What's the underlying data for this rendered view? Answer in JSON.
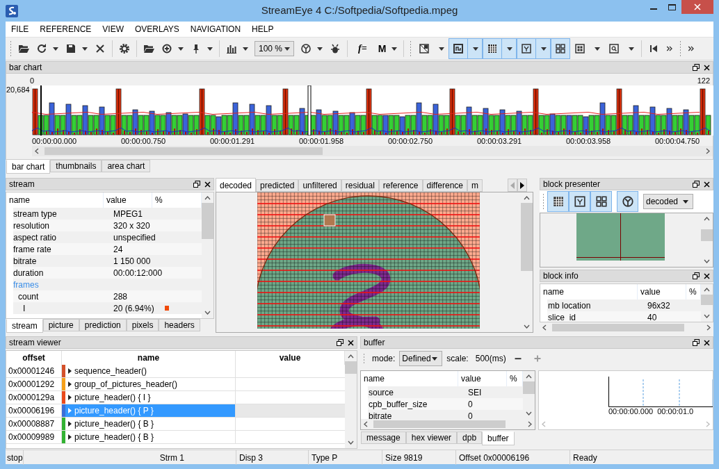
{
  "window": {
    "title": "StreamEye 4 C:/Softpedia/Softpedia.mpeg"
  },
  "menu": [
    "FILE",
    "REFERENCE",
    "VIEW",
    "OVERLAYS",
    "NAVIGATION",
    "HELP"
  ],
  "toolbar": {
    "zoom": "100 %",
    "formula": "f=",
    "macro": "M",
    "view_modes": [
      {
        "selected": false
      },
      {
        "selected": true
      },
      {
        "selected": true
      },
      {
        "selected": true
      },
      {
        "selected": true
      },
      {
        "selected": false
      },
      {
        "selected": false
      }
    ]
  },
  "bar_chart": {
    "title": "bar chart",
    "first_frame": "0",
    "last_frame": "122",
    "max_size": "20,684",
    "times": [
      "00:00:00.000",
      "00:00:00.750",
      "00:00:01.291",
      "00:00:01.958",
      "00:00:02.750",
      "00:00:03.291",
      "00:00:03.958",
      "00:00:04.750"
    ],
    "tabs": [
      {
        "label": "bar chart",
        "selected": true
      },
      {
        "label": "thumbnails",
        "selected": false
      },
      {
        "label": "area chart",
        "selected": false
      }
    ]
  },
  "stream": {
    "title": "stream",
    "columns": [
      "name",
      "value",
      "%"
    ],
    "rows": [
      {
        "kind": "property",
        "name": "stream type",
        "value": "MPEG1"
      },
      {
        "kind": "property",
        "name": "resolution",
        "value": "320 x 320"
      },
      {
        "kind": "property",
        "name": "aspect ratio",
        "value": "unspecified"
      },
      {
        "kind": "property",
        "name": "frame rate",
        "value": "24"
      },
      {
        "kind": "property",
        "name": "bitrate",
        "value": "1 150 000"
      },
      {
        "kind": "property",
        "name": "duration",
        "value": "00:00:12:000"
      },
      {
        "kind": "section",
        "name": "frames",
        "children": [
          {
            "kind": "property",
            "name": "count",
            "value": "288",
            "children": [
              {
                "kind": "property",
                "name": "I",
                "value": "20 (6.94%)",
                "color": "#f04a0a"
              }
            ]
          }
        ]
      }
    ],
    "tabs": [
      {
        "label": "stream",
        "selected": true
      },
      {
        "label": "picture",
        "selected": false
      },
      {
        "label": "prediction",
        "selected": false
      },
      {
        "label": "pixels",
        "selected": false
      },
      {
        "label": "headers",
        "selected": false
      }
    ]
  },
  "picture_tabs": [
    {
      "label": "decoded",
      "selected": true
    },
    {
      "label": "predicted",
      "selected": false
    },
    {
      "label": "unfiltered",
      "selected": false
    },
    {
      "label": "residual",
      "selected": false
    },
    {
      "label": "reference",
      "selected": false
    },
    {
      "label": "difference",
      "selected": false
    },
    {
      "label": "m",
      "selected": false
    }
  ],
  "block_presenter": {
    "title": "block presenter",
    "view": "decoded",
    "modes": [
      {
        "selected": true
      },
      {
        "selected": true
      },
      {
        "selected": true
      },
      {
        "selected": true
      }
    ]
  },
  "block_info": {
    "title": "block info",
    "columns": [
      "name",
      "value",
      "%"
    ],
    "rows": [
      {
        "name": "mb location",
        "value": "96x32"
      },
      {
        "name": "slice_id",
        "value": "40"
      }
    ]
  },
  "stream_viewer": {
    "title": "stream viewer",
    "columns": [
      "offset",
      "name",
      "value"
    ],
    "rows": [
      {
        "offset": "0x00001246",
        "name": "sequence_header()",
        "color": "#d4502a",
        "selected": false
      },
      {
        "offset": "0x00001292",
        "name": "group_of_pictures_header()",
        "color": "#f5a01a",
        "selected": false
      },
      {
        "offset": "0x0000129a",
        "name": "picture_header() { I }",
        "color": "#ea4a1c",
        "selected": false
      },
      {
        "offset": "0x00006196",
        "name": "picture_header() { P }",
        "color": "#3b6fd6",
        "selected": true
      },
      {
        "offset": "0x00008887",
        "name": "picture_header() { B }",
        "color": "#33b233",
        "selected": false
      },
      {
        "offset": "0x00009989",
        "name": "picture_header() { B }",
        "color": "#33b233",
        "selected": false
      }
    ]
  },
  "buffer": {
    "title": "buffer",
    "mode_label": "mode:",
    "mode": "Defined",
    "scale_label": "scale:",
    "scale": "500(ms)",
    "columns": [
      "name",
      "value",
      "%"
    ],
    "rows": [
      {
        "name": "source",
        "value": "SEI"
      },
      {
        "name": "cpb_buffer_size",
        "value": "0"
      },
      {
        "name": "bitrate",
        "value": "0"
      }
    ],
    "times": [
      "00:00:00.000",
      "00:00:01.0"
    ],
    "tabs": [
      {
        "label": "message",
        "selected": false
      },
      {
        "label": "hex viewer",
        "selected": false
      },
      {
        "label": "dpb",
        "selected": false
      },
      {
        "label": "buffer",
        "selected": true
      }
    ]
  },
  "status_bar": [
    "stop",
    "Strm 1",
    "Disp 3",
    "Type P",
    "Size 9819",
    "Offset 0x00006196",
    "Ready"
  ]
}
